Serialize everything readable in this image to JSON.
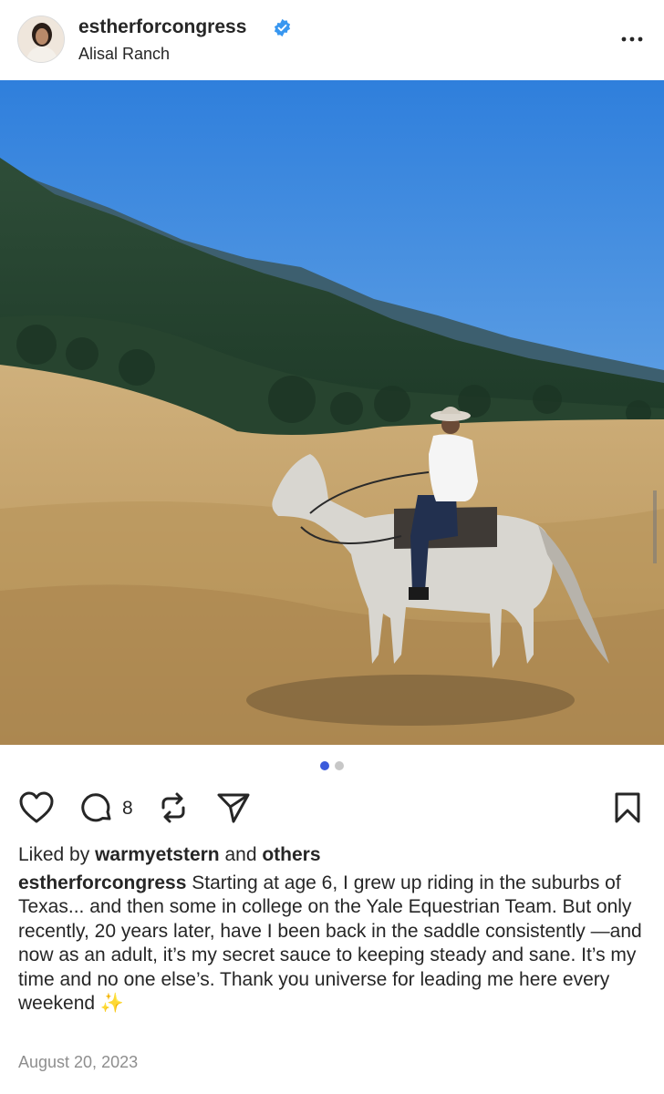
{
  "post": {
    "username": "estherforcongress",
    "location": "Alisal Ranch",
    "comment_count": "8",
    "likes_prefix": "Liked by",
    "liked_by_user": "warmyetstern",
    "likes_and": "and",
    "likes_others": "others",
    "caption_username": "estherforcongress",
    "caption_text": "Starting at age 6, I grew up riding in the suburbs of Texas... and then some in college on the Yale Equestrian Team. But only recently, 20 years later, have I been back in the saddle consistently —and now as an adult, it’s my secret sauce to keeping steady and sane. It’s my time and no one else’s. Thank you universe for leading me here every weekend ✨",
    "date": "August 20, 2023"
  },
  "carousel": {
    "total": 2,
    "active_index": 0
  },
  "colors": {
    "verified": "#3897f0",
    "active_dot": "#3b5bdb",
    "sky": "#3f86d8"
  },
  "icons": [
    "verified-badge-icon",
    "more-options-icon",
    "heart-icon",
    "comment-icon",
    "repost-icon",
    "share-icon",
    "bookmark-icon"
  ]
}
